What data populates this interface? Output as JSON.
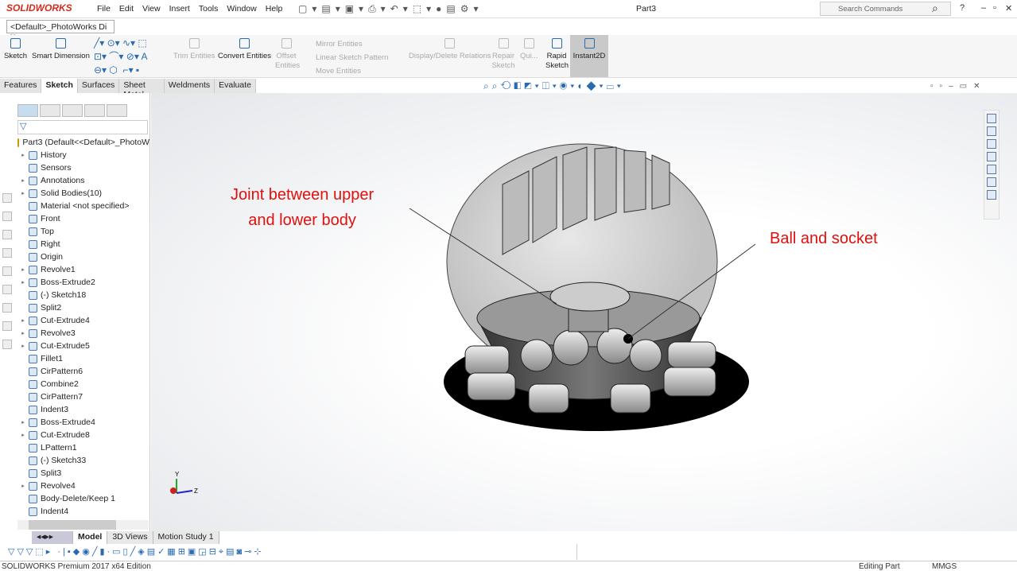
{
  "app": {
    "logo": "SOLIDWORKS",
    "document_title": "Part3",
    "search_placeholder": "Search Commands",
    "help": "?"
  },
  "menu": [
    "File",
    "Edit",
    "View",
    "Insert",
    "Tools",
    "Window",
    "Help"
  ],
  "config_dropdown": "<Default>_PhotoWorks Di",
  "ribbon": {
    "sketch": "Sketch",
    "smart_dimension": "Smart Dimension",
    "trim": "Trim Entities",
    "convert": "Convert Entities",
    "offset": "Offset Entities",
    "mirror": "Mirror Entities",
    "linear_pattern": "Linear Sketch Pattern",
    "move": "Move Entities",
    "display_relations": "Display/Delete Relations",
    "repair": "Repair Sketch",
    "quick": "Qui...",
    "rapid": "Rapid Sketch",
    "instant2d": "Instant2D"
  },
  "tabs": [
    {
      "label": "Features"
    },
    {
      "label": "Sketch",
      "active": true
    },
    {
      "label": "Surfaces"
    },
    {
      "label": "Sheet Metal"
    },
    {
      "label": "Weldments"
    },
    {
      "label": "Evaluate"
    }
  ],
  "tree": {
    "root": "Part3  (Default<<Default>_PhotoW",
    "items": [
      {
        "label": "History",
        "exp": true
      },
      {
        "label": "Sensors"
      },
      {
        "label": "Annotations",
        "exp": true
      },
      {
        "label": "Solid Bodies(10)",
        "exp": true
      },
      {
        "label": "Material <not specified>"
      },
      {
        "label": "Front"
      },
      {
        "label": "Top"
      },
      {
        "label": "Right"
      },
      {
        "label": "Origin"
      },
      {
        "label": "Revolve1",
        "exp": true
      },
      {
        "label": "Boss-Extrude2",
        "exp": true
      },
      {
        "label": "(-) Sketch18"
      },
      {
        "label": "Split2"
      },
      {
        "label": "Cut-Extrude4",
        "exp": true
      },
      {
        "label": "Revolve3",
        "exp": true
      },
      {
        "label": "Cut-Extrude5",
        "exp": true
      },
      {
        "label": "Fillet1"
      },
      {
        "label": "CirPattern6"
      },
      {
        "label": "Combine2"
      },
      {
        "label": "CirPattern7"
      },
      {
        "label": "Indent3"
      },
      {
        "label": "Boss-Extrude4",
        "exp": true
      },
      {
        "label": "Cut-Extrude8",
        "exp": true
      },
      {
        "label": "LPattern1"
      },
      {
        "label": "(-) Sketch33"
      },
      {
        "label": "Split3"
      },
      {
        "label": "Revolve4",
        "exp": true
      },
      {
        "label": "Body-Delete/Keep 1"
      },
      {
        "label": "Indent4"
      }
    ]
  },
  "annotations": {
    "joint": "Joint between upper\nand lower body",
    "ball": "Ball and socket"
  },
  "triad": {
    "x": "Z",
    "y": "Y"
  },
  "bottom_tabs": [
    {
      "label": "Model",
      "active": true
    },
    {
      "label": "3D Views"
    },
    {
      "label": "Motion Study 1"
    }
  ],
  "status": {
    "edition": "SOLIDWORKS Premium 2017 x64 Edition",
    "mode": "Editing Part",
    "units": "MMGS"
  },
  "colors": {
    "accent": "#2a6ab0",
    "annotation": "#e0100e",
    "brand": "#d52b1e"
  }
}
